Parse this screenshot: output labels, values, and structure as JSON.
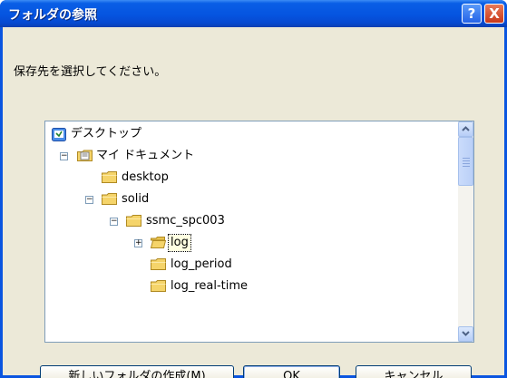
{
  "window": {
    "title": "フォルダの参照"
  },
  "title_buttons": {
    "help": "?",
    "close": "X"
  },
  "prompt": "保存先を選択してください。",
  "tree": {
    "items": [
      {
        "label": "デスクトップ",
        "icon": "desktop-icon",
        "expander": ""
      },
      {
        "label": "マイ ドキュメント",
        "icon": "documents-folder-icon",
        "expander": "−"
      },
      {
        "label": "desktop",
        "icon": "folder-icon",
        "expander": ""
      },
      {
        "label": "solid",
        "icon": "folder-icon",
        "expander": "−"
      },
      {
        "label": "ssmc_spc003",
        "icon": "folder-icon",
        "expander": "−"
      },
      {
        "label": "log",
        "icon": "folder-icon",
        "expander": "+",
        "selected": true
      },
      {
        "label": "log_period",
        "icon": "folder-icon",
        "expander": ""
      },
      {
        "label": "log_real-time",
        "icon": "folder-icon",
        "expander": ""
      }
    ]
  },
  "buttons": {
    "new_folder": "新しいフォルダの作成(M)",
    "ok": "OK",
    "cancel": "キャンセル"
  },
  "colors": {
    "title_bar": "#0554e0",
    "client": "#ece9d8",
    "folder": "#f5d46a"
  }
}
